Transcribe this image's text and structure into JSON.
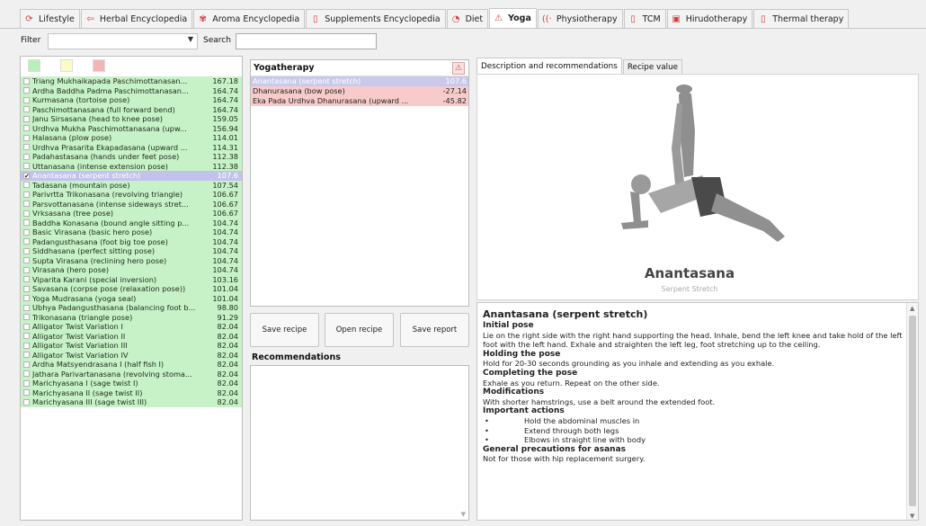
{
  "tabs": [
    {
      "label": "Lifestyle",
      "icon": "lifestyle-icon",
      "glyph": "⟳",
      "color": "#d04040"
    },
    {
      "label": "Herbal Encyclopedia",
      "icon": "herbal-icon",
      "glyph": "⇦",
      "color": "#d04040"
    },
    {
      "label": "Aroma Encyclopedia",
      "icon": "aroma-icon",
      "glyph": "✾",
      "color": "#d04040"
    },
    {
      "label": "Supplements Encyclopedia",
      "icon": "supplements-icon",
      "glyph": "▯",
      "color": "#d04040"
    },
    {
      "label": "Diet",
      "icon": "diet-icon",
      "glyph": "◔",
      "color": "#d04040"
    },
    {
      "label": "Yoga",
      "icon": "yoga-icon",
      "glyph": "⚠",
      "color": "#d04040"
    },
    {
      "label": "Physiotherapy",
      "icon": "physiotherapy-icon",
      "glyph": "((·",
      "color": "#d04040"
    },
    {
      "label": "TCM",
      "icon": "tcm-icon",
      "glyph": "▯",
      "color": "#d04040"
    },
    {
      "label": "Hirudotherapy",
      "icon": "hirudotherapy-icon",
      "glyph": "▣",
      "color": "#d04040"
    },
    {
      "label": "Thermal therapy",
      "icon": "thermal-icon",
      "glyph": "▯",
      "color": "#d04040"
    }
  ],
  "active_tab": "Yoga",
  "filter": {
    "label": "Filter",
    "value": "",
    "search_label": "Search",
    "search_value": ""
  },
  "colors": {
    "green_row": "#c7f2c7",
    "selected_row": "#c2c2ec",
    "pink_row": "#f8cbcb",
    "swatch_green": "#b8f0b8",
    "swatch_yellow": "#fbfbc8",
    "swatch_red": "#f2b5b5"
  },
  "poses": [
    {
      "name": "Triang Mukhaikapada Paschimottanasan...",
      "value": "167.18",
      "checked": false
    },
    {
      "name": "Ardha Baddha Padma Paschimottanasan...",
      "value": "164.74",
      "checked": false
    },
    {
      "name": "Kurmasana (tortoise pose)",
      "value": "164.74",
      "checked": false
    },
    {
      "name": "Paschimottanasana (full forward bend)",
      "value": "164.74",
      "checked": false
    },
    {
      "name": "Janu Sirsasana (head to knee pose)",
      "value": "159.05",
      "checked": false
    },
    {
      "name": "Urdhva Mukha Paschimottanasana (upw...",
      "value": "156.94",
      "checked": false
    },
    {
      "name": "Halasana (plow pose)",
      "value": "114.01",
      "checked": false
    },
    {
      "name": "Urdhva Prasarita Ekapadasana (upward ...",
      "value": "114.31",
      "checked": false
    },
    {
      "name": "Padahastasana (hands under feet pose)",
      "value": "112.38",
      "checked": false
    },
    {
      "name": "Uttanasana (intense extension pose)",
      "value": "112.38",
      "checked": false
    },
    {
      "name": "Anantasana (serpent stretch)",
      "value": "107.6",
      "checked": true,
      "selected": true
    },
    {
      "name": "Tadasana (mountain pose)",
      "value": "107.54",
      "checked": false
    },
    {
      "name": "Parivrtta Trikonasana (revolving triangle)",
      "value": "106.67",
      "checked": false
    },
    {
      "name": "Parsvottanasana (intense sideways stret...",
      "value": "106.67",
      "checked": false
    },
    {
      "name": "Vrksasana (tree pose)",
      "value": "106.67",
      "checked": false
    },
    {
      "name": "Baddha Konasana (bound angle sitting p...",
      "value": "104.74",
      "checked": false
    },
    {
      "name": "Basic Virasana (basic hero pose)",
      "value": "104.74",
      "checked": false
    },
    {
      "name": "Padangusthasana (foot big toe pose)",
      "value": "104.74",
      "checked": false
    },
    {
      "name": "Siddhasana (perfect sitting pose)",
      "value": "104.74",
      "checked": false
    },
    {
      "name": "Supta Virasana (reclining hero pose)",
      "value": "104.74",
      "checked": false
    },
    {
      "name": "Virasana (hero pose)",
      "value": "104.74",
      "checked": false
    },
    {
      "name": "Viparita Karani (special inversion)",
      "value": "103.16",
      "checked": false
    },
    {
      "name": "Savasana (corpse pose (relaxation pose))",
      "value": "101.04",
      "checked": false
    },
    {
      "name": "Yoga Mudrasana (yoga seal)",
      "value": "101.04",
      "checked": false
    },
    {
      "name": "Ubhya Padangusthasana (balancing foot b...",
      "value": "98.80",
      "checked": false
    },
    {
      "name": "Trikonasana (triangle pose)",
      "value": "91.29",
      "checked": false
    },
    {
      "name": "Alligator Twist Variation I",
      "value": "82.04",
      "checked": false
    },
    {
      "name": "Alligator Twist Variation II",
      "value": "82.04",
      "checked": false
    },
    {
      "name": "Alligator Twist Variation III",
      "value": "82.04",
      "checked": false
    },
    {
      "name": "Alligator Twist Variation IV",
      "value": "82.04",
      "checked": false
    },
    {
      "name": "Ardha Matsyendrasana I (half fish I)",
      "value": "82.04",
      "checked": false
    },
    {
      "name": "Jathara Parivartanasana (revolving stoma...",
      "value": "82.04",
      "checked": false
    },
    {
      "name": "Marichyasana I (sage twist I)",
      "value": "82.04",
      "checked": false
    },
    {
      "name": "Marichyasana II (sage twist II)",
      "value": "82.04",
      "checked": false
    },
    {
      "name": "Marichyasana III (sage twist III)",
      "value": "82.04",
      "checked": false
    }
  ],
  "yogatherapy": {
    "title": "Yogatherapy",
    "icon": "yoga-warning-icon",
    "items": [
      {
        "name": "Anantasana (serpent stretch)",
        "value": "107.6",
        "style": "sel"
      },
      {
        "name": "Dhanurasana (bow pose)",
        "value": "-27.14",
        "style": "pink"
      },
      {
        "name": "Eka Pada Urdhva Dhanurasana (upward ...",
        "value": "-45.82",
        "style": "pink"
      }
    ]
  },
  "buttons": {
    "save_recipe": "Save recipe",
    "open_recipe": "Open recipe",
    "save_report": "Save report"
  },
  "recommendations": {
    "title": "Recommendations"
  },
  "desc_tabs": {
    "description": "Description and recommendations",
    "recipe": "Recipe value"
  },
  "pose_image": {
    "title": "Anantasana",
    "subtitle": "Serpent Stretch"
  },
  "description": {
    "title": "Anantasana (serpent stretch)",
    "sections": [
      {
        "heading": "Initial pose",
        "text": "Lie on the right side with the right hand supporting the head. Inhale, bend the left knee and take hold of the left foot with the left hand. Exhale and straighten the left leg, foot stretching up to the ceiling."
      },
      {
        "heading": "Holding the pose",
        "text": "Hold for 20-30 seconds grounding as you inhale and extending as you exhale."
      },
      {
        "heading": "Completing the pose",
        "text": "Exhale as you return. Repeat on the other side."
      },
      {
        "heading": "Modifications",
        "text": "With shorter hamstrings, use a belt around the extended foot."
      },
      {
        "heading": "Important actions",
        "bullets": [
          "Hold the abdominal muscles in",
          "Extend through both legs",
          "Elbows in straight line with body"
        ]
      },
      {
        "heading": "General precautions for asanas",
        "text": "Not for those with hip replacement surgery."
      }
    ]
  }
}
